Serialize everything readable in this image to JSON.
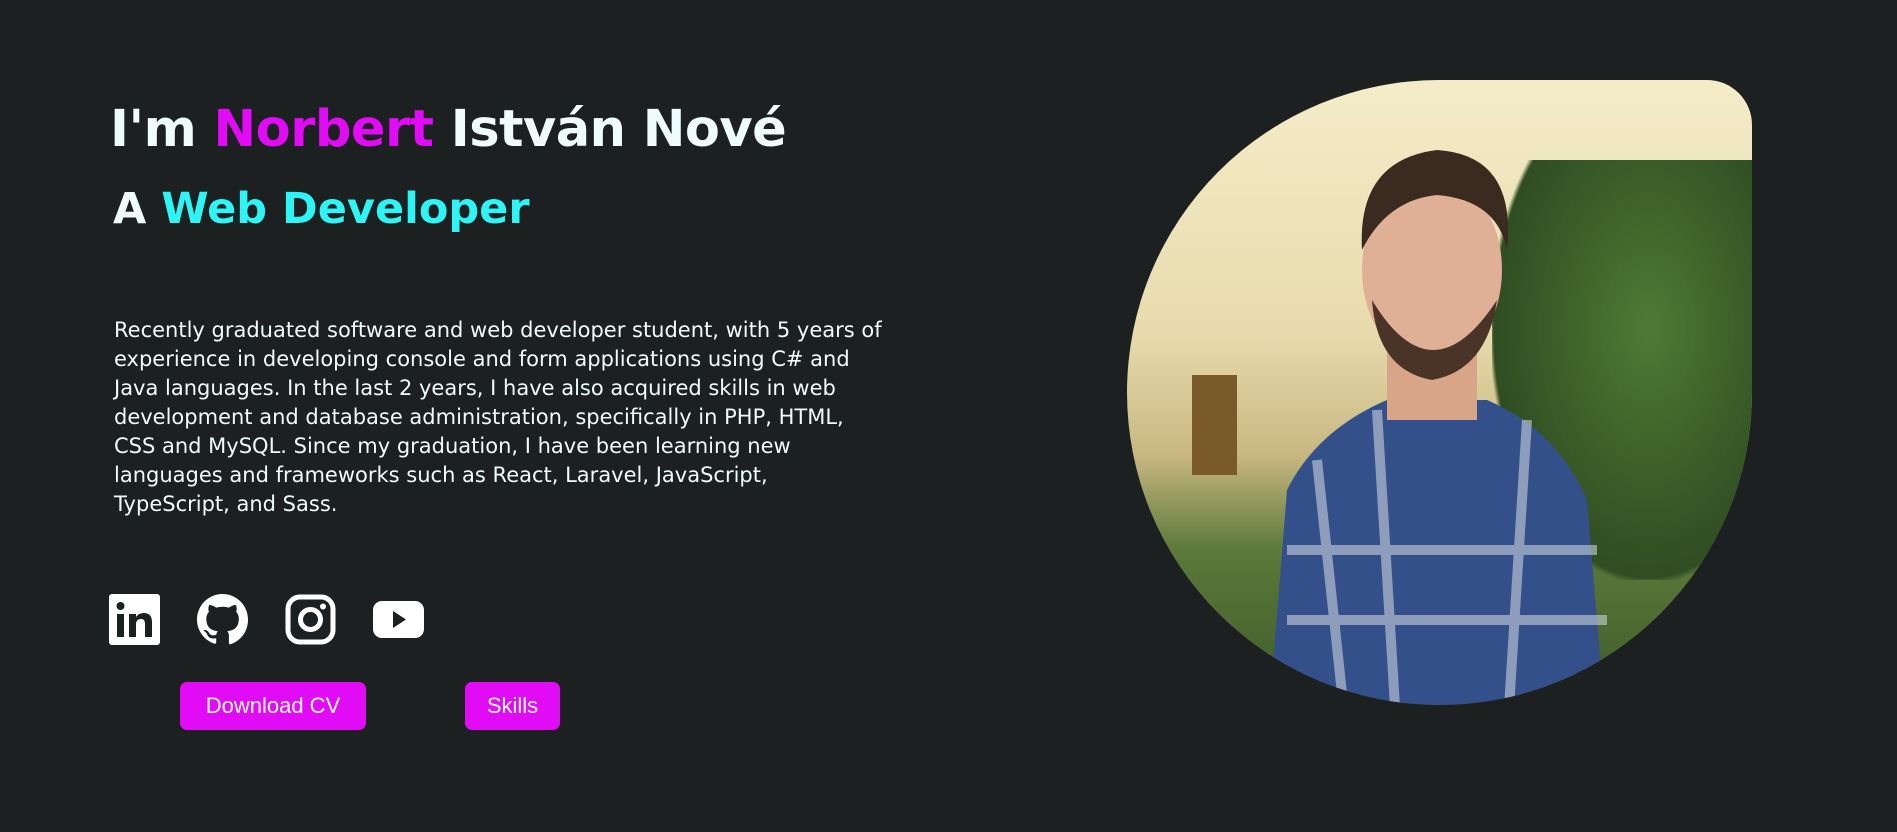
{
  "hero": {
    "title_prefix": "I'm ",
    "title_first": "Norbert",
    "title_rest": " István Nové",
    "subtitle_prefix": "A ",
    "subtitle_role": "Web Developer",
    "description": "Recently graduated software and web developer student, with 5 years of experience in developing console and form applications using C# and Java languages. In the last 2 years, I have also acquired skills in web development and database administration, specifically in PHP, HTML, CSS and MySQL. Since my graduation, I have been learning new languages and frameworks such as React, Laravel, JavaScript, TypeScript, and Sass."
  },
  "social": [
    "linkedin-icon",
    "github-icon",
    "instagram-icon",
    "youtube-icon"
  ],
  "buttons": {
    "download_cv": "Download CV",
    "skills": "Skills"
  },
  "colors": {
    "background": "#1c2021",
    "accent_pink": "#e10bf5",
    "accent_cyan": "#2ef5f5",
    "text": "#f0fcfc"
  }
}
